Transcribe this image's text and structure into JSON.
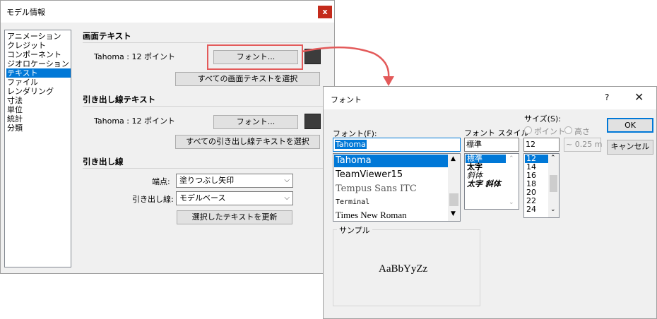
{
  "model_info": {
    "title": "モデル情報",
    "close": "x",
    "categories": [
      "アニメーション",
      "クレジット",
      "コンポーネント",
      "ジオロケーション",
      "テキスト",
      "ファイル",
      "レンダリング",
      "寸法",
      "単位",
      "統計",
      "分類"
    ],
    "selected_category": 4,
    "screen_text": {
      "heading": "画面テキスト",
      "font_info": "Tahoma : 12 ポイント",
      "font_button": "フォント...",
      "select_all_button": "すべての画面テキストを選択"
    },
    "leader_text": {
      "heading": "引き出し線テキスト",
      "font_info": "Tahoma : 12 ポイント",
      "font_button": "フォント...",
      "select_all_button": "すべての引き出し線テキストを選択"
    },
    "leader_line": {
      "heading": "引き出し線",
      "endpoint_label": "端点:",
      "endpoint_value": "塗りつぶし矢印",
      "leader_label": "引き出し線:",
      "leader_value": "モデルベース",
      "update_button": "選択したテキストを更新"
    },
    "swatch_color": "#3c3c3c"
  },
  "font_dialog": {
    "title": "フォント",
    "help": "?",
    "close": "✕",
    "font_label": "フォント(F):",
    "font_value": "Tahoma",
    "fonts": [
      "Tahoma",
      "TeamViewer15",
      "Tempus Sans ITC",
      "Terminal",
      "Times New Roman"
    ],
    "style_label": "フォント スタイル",
    "style_value": "標準",
    "styles": [
      "標準",
      "太字",
      "斜体",
      "太字 斜体"
    ],
    "size_label": "サイズ(S):",
    "size_point": "ポイント",
    "size_height": "高さ",
    "size_value": "12",
    "sizes": [
      "12",
      "14",
      "16",
      "18",
      "20",
      "22",
      "24"
    ],
    "height_value": "~ 0.25 m",
    "ok": "OK",
    "cancel": "キャンセル",
    "sample_label": "サンプル",
    "sample_text": "AaBbYyZz"
  }
}
